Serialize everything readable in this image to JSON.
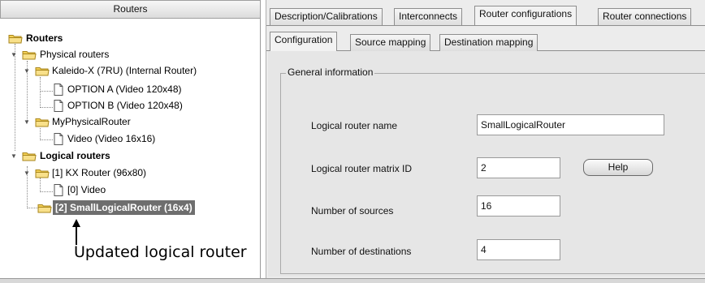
{
  "left_panel": {
    "header": "Routers",
    "tree": {
      "root": "Routers",
      "physical": "Physical routers",
      "kaleido": "Kaleido-X (7RU) (Internal Router)",
      "option_a": "OPTION A (Video 120x48)",
      "option_b": "OPTION B (Video 120x48)",
      "my_physical": "MyPhysicalRouter",
      "video": "Video (Video 16x16)",
      "logical": "Logical routers",
      "kx_router": "[1] KX Router (96x80)",
      "kx_video": "[0] Video",
      "small_logical": "[2] SmallLogicalRouter (16x4)"
    },
    "annotation": "Updated logical router"
  },
  "tabs": [
    "Description/Calibrations",
    "Interconnects",
    "Router configurations",
    "Router connections"
  ],
  "active_tab": "Router configurations",
  "subtabs": [
    "Configuration",
    "Source mapping",
    "Destination mapping"
  ],
  "active_subtab": "Configuration",
  "form": {
    "group_title": "General information",
    "name_label": "Logical router name",
    "name_value": "SmallLogicalRouter",
    "matrix_label": "Logical router matrix ID",
    "matrix_value": "2",
    "help_label": "Help",
    "sources_label": "Number of sources",
    "sources_value": "16",
    "destinations_label": "Number of destinations",
    "destinations_value": "4"
  },
  "colors": {
    "folder": "#f3cf55",
    "selected_background": "#6e6e6e",
    "panel_background": "#ececec"
  },
  "icons": {
    "folder": "folder-icon",
    "file": "document-icon",
    "expand": "expand-toggle-icon"
  }
}
